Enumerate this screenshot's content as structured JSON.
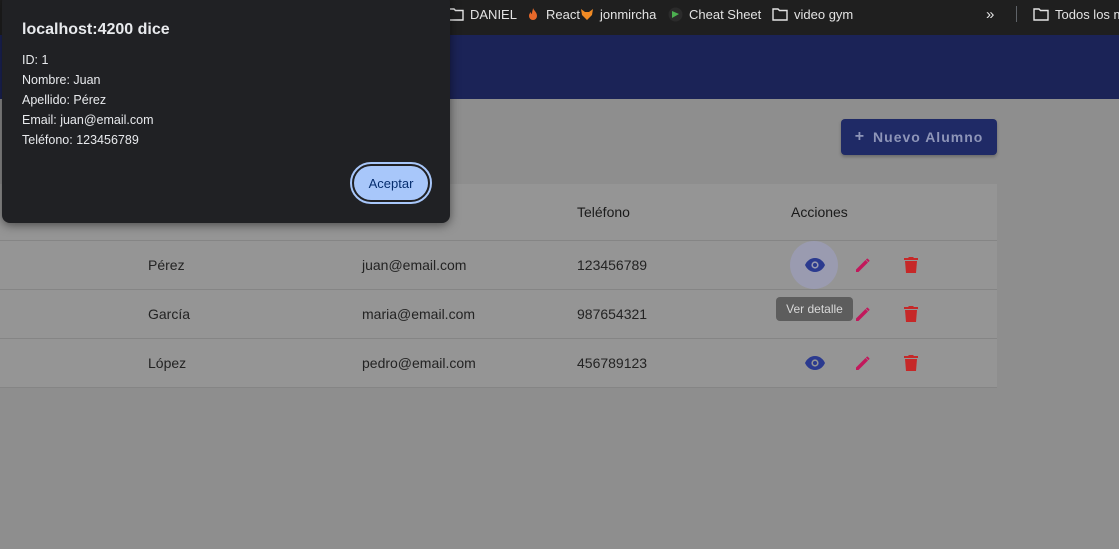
{
  "bookmarks": {
    "items": [
      {
        "label": "DANIEL",
        "icon": "folder-icon"
      },
      {
        "label": "React",
        "icon": "react-fire-icon"
      },
      {
        "label": "jonmircha",
        "icon": "fox-icon"
      },
      {
        "label": "Cheat Sheet",
        "icon": "cheat-sheet-icon"
      },
      {
        "label": "video gym",
        "icon": "folder-icon"
      }
    ],
    "more_label": "»",
    "all_bookmarks_label": "Todos los m"
  },
  "actions": {
    "new_student_label": "Nuevo Alumno"
  },
  "table": {
    "headers": [
      "Teléfono",
      "Acciones"
    ],
    "rows": [
      {
        "apellido": "Pérez",
        "email": "juan@email.com",
        "telefono": "123456789"
      },
      {
        "apellido": "García",
        "email": "maria@email.com",
        "telefono": "987654321"
      },
      {
        "apellido": "López",
        "email": "pedro@email.com",
        "telefono": "456789123"
      }
    ]
  },
  "tooltip": {
    "text": "Ver detalle"
  },
  "dialog": {
    "title": "localhost:4200 dice",
    "lines": [
      "ID: 1",
      "Nombre: Juan",
      "Apellido: Pérez",
      "Email: juan@email.com",
      "Teléfono: 123456789"
    ],
    "ok_label": "Aceptar"
  },
  "colors": {
    "header": "#1b2357",
    "primary_button": "#1f2a66",
    "view_icon": "#2b3a8f",
    "edit_icon": "#c2185b",
    "delete_icon": "#c62828",
    "dialog_button": "#a8c7fa"
  }
}
